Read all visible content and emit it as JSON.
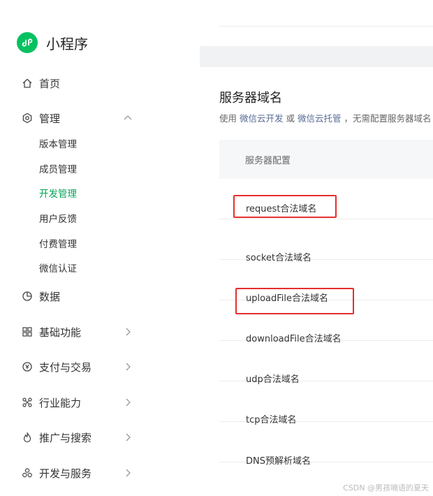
{
  "app": {
    "title": "小程序"
  },
  "sidebar": {
    "items": [
      {
        "label": "首页"
      },
      {
        "label": "管理"
      },
      {
        "label": "数据"
      },
      {
        "label": "基础功能"
      },
      {
        "label": "支付与交易"
      },
      {
        "label": "行业能力"
      },
      {
        "label": "推广与搜索"
      },
      {
        "label": "开发与服务"
      }
    ],
    "manage_children": [
      {
        "label": "版本管理"
      },
      {
        "label": "成员管理"
      },
      {
        "label": "开发管理",
        "active": true
      },
      {
        "label": "用户反馈"
      },
      {
        "label": "付费管理"
      },
      {
        "label": "微信认证"
      }
    ]
  },
  "server_domain": {
    "title": "服务器域名",
    "desc_prefix": "使用",
    "link1": "微信云开发",
    "desc_or": "或",
    "link2": "微信云托管",
    "desc_suffix": "，无需配置服务器域名",
    "table_header": "服务器配置",
    "rows": [
      {
        "label": "request合法域名"
      },
      {
        "label": "socket合法域名"
      },
      {
        "label": "uploadFile合法域名"
      },
      {
        "label": "downloadFile合法域名"
      },
      {
        "label": "udp合法域名"
      },
      {
        "label": "tcp合法域名"
      },
      {
        "label": "DNS预解析域名"
      }
    ]
  },
  "watermark": "CSDN @男孩喃语的夏天",
  "colors": {
    "accent": "#07c160",
    "link": "#576b95",
    "highlight": "#e62e2e"
  }
}
